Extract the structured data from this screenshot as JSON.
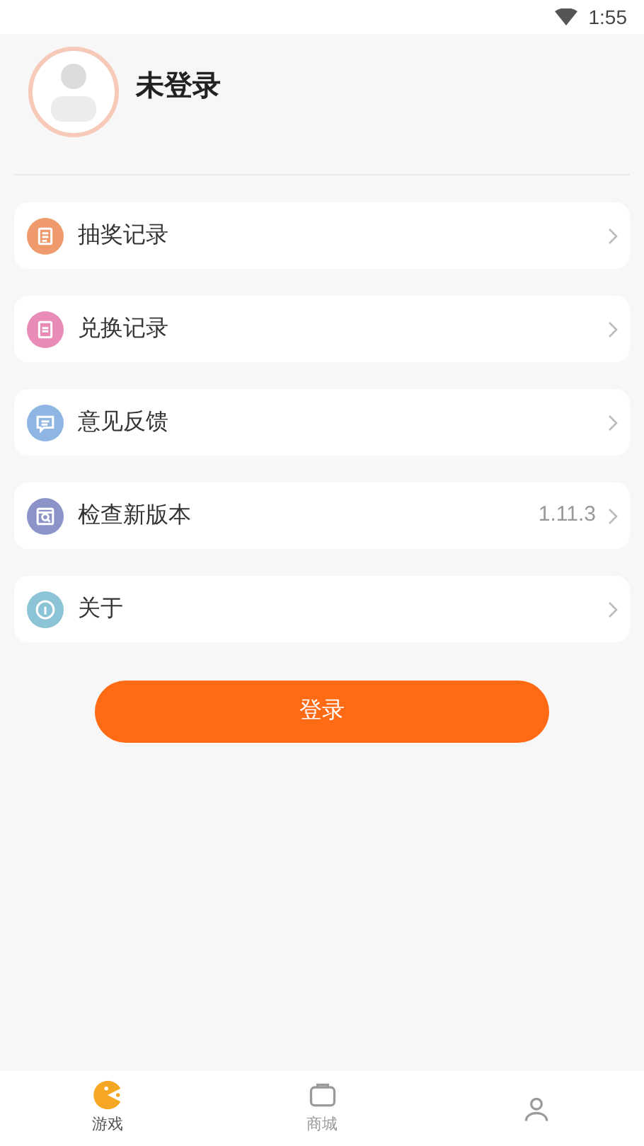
{
  "status_bar": {
    "time": "1:55"
  },
  "profile": {
    "name": "未登录"
  },
  "menu": [
    {
      "label": "抽奖记录",
      "color": "#ef9a6c",
      "kind": "list"
    },
    {
      "label": "兑换记录",
      "color": "#e88bb6",
      "kind": "exchange"
    },
    {
      "label": "意见反馈",
      "color": "#8fb6e3",
      "kind": "chat"
    },
    {
      "label": "检查新版本",
      "color": "#8c93c9",
      "kind": "update",
      "value": "1.11.3"
    },
    {
      "label": "关于",
      "color": "#8cc3d6",
      "kind": "info"
    }
  ],
  "login_button": "登录",
  "tabs": [
    {
      "label": "游戏",
      "kind": "game",
      "selected": true
    },
    {
      "label": "商城",
      "kind": "shop",
      "selected": false
    },
    {
      "kind": "person",
      "selected": false
    }
  ]
}
